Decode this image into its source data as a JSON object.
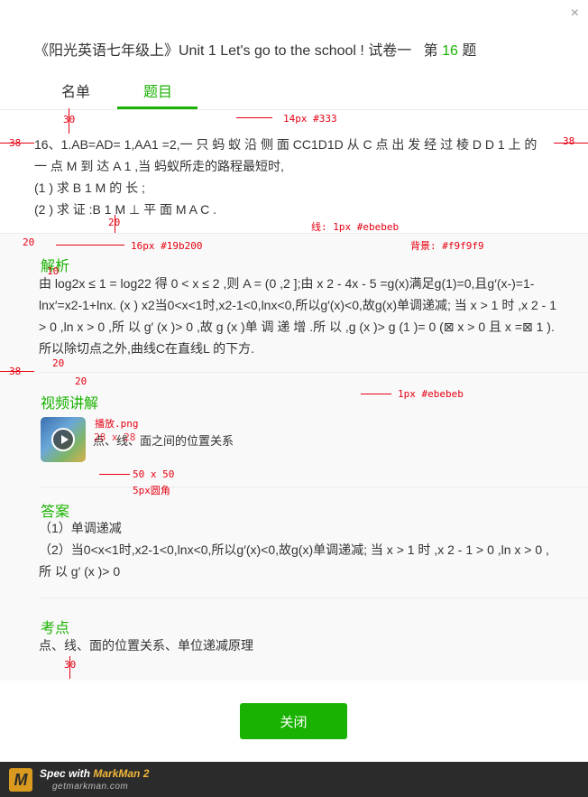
{
  "dialog": {
    "title_prefix": "《阳光英语七年级上》Unit 1 Let's go to the school ! 试卷一",
    "title_question_word": "第",
    "question_number": "16",
    "title_suffix": "题",
    "close_glyph": "×"
  },
  "tabs": [
    {
      "label": "名单",
      "active": false
    },
    {
      "label": "题目",
      "active": true
    }
  ],
  "question": {
    "lines": [
      "16、1.AB=AD= 1,AA1 =2,一 只 蚂 蚁 沿 侧 面 CC1D1D 从 C 点 出 发 经 过 棱 D D 1 上 的",
      "一 点 M 到 达 A 1 ,当 蚂蚁所走的路程最短时,",
      "(1 ) 求 B 1 M 的 长 ;",
      "(2 ) 求 证 :B 1 M ⊥ 平 面 M A C ."
    ]
  },
  "analysis": {
    "title": "解析",
    "text": "由 log2x ≤ 1 = log22 得 0 < x ≤ 2 ,则 A = (0 ,2 ];由 x 2 - 4x - 5 =g(x)满足g(1)=0,且g′(x-)=1- lnx′=x2-1+lnx. (x ) x2当0<x<1时,x2-1<0,lnx<0,所以g′(x)<0,故g(x)单调递减; 当 x > 1 时 ,x 2 - 1 > 0 ,ln x > 0 ,所 以 g′ (x )> 0 ,故 g (x )单 调 递 增 .所 以 ,g (x )> g (1 )= 0 (⊠ x > 0 且 x =⊠ 1 ). 所以除切点之外,曲线C在直线L 的下方."
  },
  "video": {
    "title": "视频讲解",
    "label": "点、线、面之间的位置关系",
    "icon": "play-icon"
  },
  "answer": {
    "title": "答案",
    "lines": [
      "（1）单调递减",
      "（2）当0<x<1时,x2-1<0,lnx<0,所以g′(x)<0,故g(x)单调递减; 当 x > 1 时 ,x 2 - 1 > 0 ,ln x > 0 ,所 以 g′ (x )> 0"
    ]
  },
  "knowledge": {
    "title": "考点",
    "text": "点、线、面的位置关系、单位递减原理"
  },
  "footer": {
    "close_label": "关闭"
  },
  "markman": {
    "spec_with": "Spec with",
    "brand": "MarkMan 2",
    "url": "getmarkman.com",
    "logo": "M"
  },
  "annotations": {
    "a30_top": "30",
    "a38_left": "38",
    "a38_right": "38",
    "font_q": "14px #333",
    "a20_mid": "20",
    "a20_left": "20",
    "line_note": "线: 1px #ebebeb",
    "font_sec": "16px #19b200",
    "bg_note": "背景: #f9f9f9",
    "a10": "10",
    "a38_left2": "38",
    "a20_b": "20",
    "a20_c": "20",
    "line_note2": "1px #ebebeb",
    "play_png": "播放.png",
    "play_size": "28 x 28",
    "thumb_size": "50 x 50",
    "thumb_radius": "5px圆角",
    "a30_bottom": "30"
  },
  "colors": {
    "accent": "#19b200",
    "text": "#333333",
    "divider": "#ebebeb",
    "panel_bg": "#f9f9f9",
    "annotation": "#e60012"
  }
}
